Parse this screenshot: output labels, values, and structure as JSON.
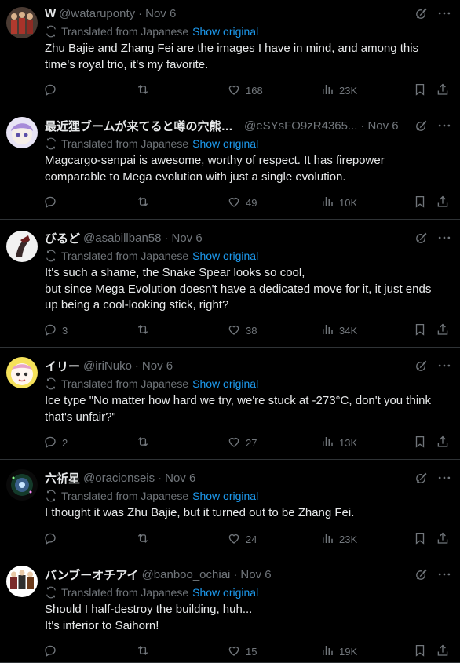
{
  "common": {
    "translated_label": "Translated from Japanese",
    "show_original_label": "Show original"
  },
  "tweets": [
    {
      "name": "W",
      "handle": "@wataruponty",
      "date": "Nov 6",
      "body": [
        "Zhu Bajie and Zhang Fei are the images I have in mind, and among this",
        "time's royal trio, it's my favorite."
      ],
      "replies": "",
      "reposts": "",
      "likes": "168",
      "views": "23K",
      "avatar_color": "#6b4e3d"
    },
    {
      "name": "最近狸ブームが来てると噂の穴熊ム...",
      "handle": "@eSYsFO9zR4365...",
      "date": "Nov 6",
      "body": [
        "Magcargo-senpai is awesome, worthy of respect. It has firepower",
        "comparable to Mega evolution with just a single evolution."
      ],
      "replies": "",
      "reposts": "",
      "likes": "49",
      "views": "10K",
      "avatar_color": "#a78bd9"
    },
    {
      "name": "びるど",
      "handle": "@asabillban58",
      "date": "Nov 6",
      "body": [
        "It's such a shame, the Snake Spear looks so cool,",
        "but since Mega Evolution doesn't have a dedicated move for it, it just ends",
        "up being a cool-looking stick, right?"
      ],
      "replies": "3",
      "reposts": "",
      "likes": "38",
      "views": "34K",
      "avatar_color": "#f2f2f2"
    },
    {
      "name": "イリー",
      "handle": "@iriNuko",
      "date": "Nov 6",
      "body": [
        "Ice type \"No matter how hard we try, we're stuck at -273°C, don't you think",
        "that's unfair?\""
      ],
      "replies": "2",
      "reposts": "",
      "likes": "27",
      "views": "13K",
      "avatar_color": "#f5e15a"
    },
    {
      "name": "六祈星",
      "handle": "@oracionseis",
      "date": "Nov 6",
      "body": [
        "I thought it was Zhu Bajie, but it turned out to be Zhang Fei."
      ],
      "replies": "",
      "reposts": "",
      "likes": "24",
      "views": "23K",
      "avatar_color": "#1a1a1a"
    },
    {
      "name": "バンブーオチアイ",
      "handle": "@banboo_ochiai",
      "date": "Nov 6",
      "body": [
        "Should I half-destroy the building, huh...",
        "It's inferior to Saihorn!"
      ],
      "replies": "",
      "reposts": "",
      "likes": "15",
      "views": "19K",
      "avatar_color": "#ffffff"
    }
  ],
  "colors": {
    "background": "#000000",
    "text": "#e7e9ea",
    "muted": "#71767b",
    "link": "#1d9bf0",
    "divider": "#2f3336"
  }
}
